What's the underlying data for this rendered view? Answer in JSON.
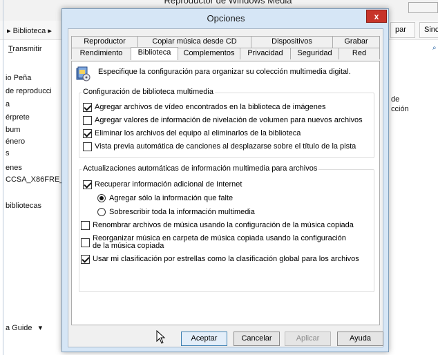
{
  "background_window": {
    "title": "Reproductor de Windows Media",
    "nav_library": "Biblioteca",
    "transmitir_rest": "ransmitir",
    "transmitir_first": "T",
    "sidebar_fragments": [
      "io Peña",
      "de reproducci",
      "a",
      "érprete",
      "bum",
      "énero",
      "s",
      "enes",
      "CCSA_X86FRE_",
      "",
      "bibliotecas"
    ],
    "guide_label": "a Guide",
    "right_tabs": [
      "par",
      "Sinc"
    ],
    "right_text_1": "de",
    "right_text_2": "cción"
  },
  "dialog": {
    "title": "Opciones",
    "close_glyph": "x",
    "tabs_row1": [
      "Reproductor",
      "Copiar música desde CD",
      "Dispositivos",
      "Grabar"
    ],
    "tabs_row2": [
      "Rendimiento",
      "Biblioteca",
      "Complementos",
      "Privacidad",
      "Seguridad",
      "Red"
    ],
    "active_tab": "Biblioteca",
    "intro_text": "Especifique la configuración para organizar su colección multimedia digital.",
    "group1": {
      "legend": "Configuración de biblioteca multimedia",
      "options": [
        {
          "label": "Agregar archivos de vídeo encontrados en la biblioteca de imágenes",
          "checked": true
        },
        {
          "label": "Agregar valores de información de nivelación de volumen para nuevos archivos",
          "checked": false
        },
        {
          "label": "Eliminar los archivos del equipo al eliminarlos de la biblioteca",
          "checked": true
        },
        {
          "label": "Vista previa automática de canciones al desplazarse sobre el título de la pista",
          "checked": false
        }
      ]
    },
    "group2": {
      "legend": "Actualizaciones automáticas de información multimedia para archivos",
      "retrieve": {
        "label": "Recuperar información adicional de Internet",
        "checked": true
      },
      "radio_missing": {
        "label": "Agregar sólo la información que falte",
        "checked": true
      },
      "radio_overwrite": {
        "label": "Sobrescribir toda la información multimedia",
        "checked": false
      },
      "rename": {
        "label": "Renombrar archivos de música usando la configuración de la música copiada",
        "checked": false
      },
      "reorganize": {
        "label_line1": "Reorganizar música en carpeta de música copiada usando la configuración",
        "label_line2": "de la música copiada",
        "checked": false
      },
      "ratings": {
        "label": "Usar mi clasificación por estrellas como la clasificación global para los archivos",
        "checked": true
      }
    },
    "buttons": {
      "ok": "Aceptar",
      "cancel": "Cancelar",
      "apply": "Aplicar",
      "help": "Ayuda"
    }
  }
}
